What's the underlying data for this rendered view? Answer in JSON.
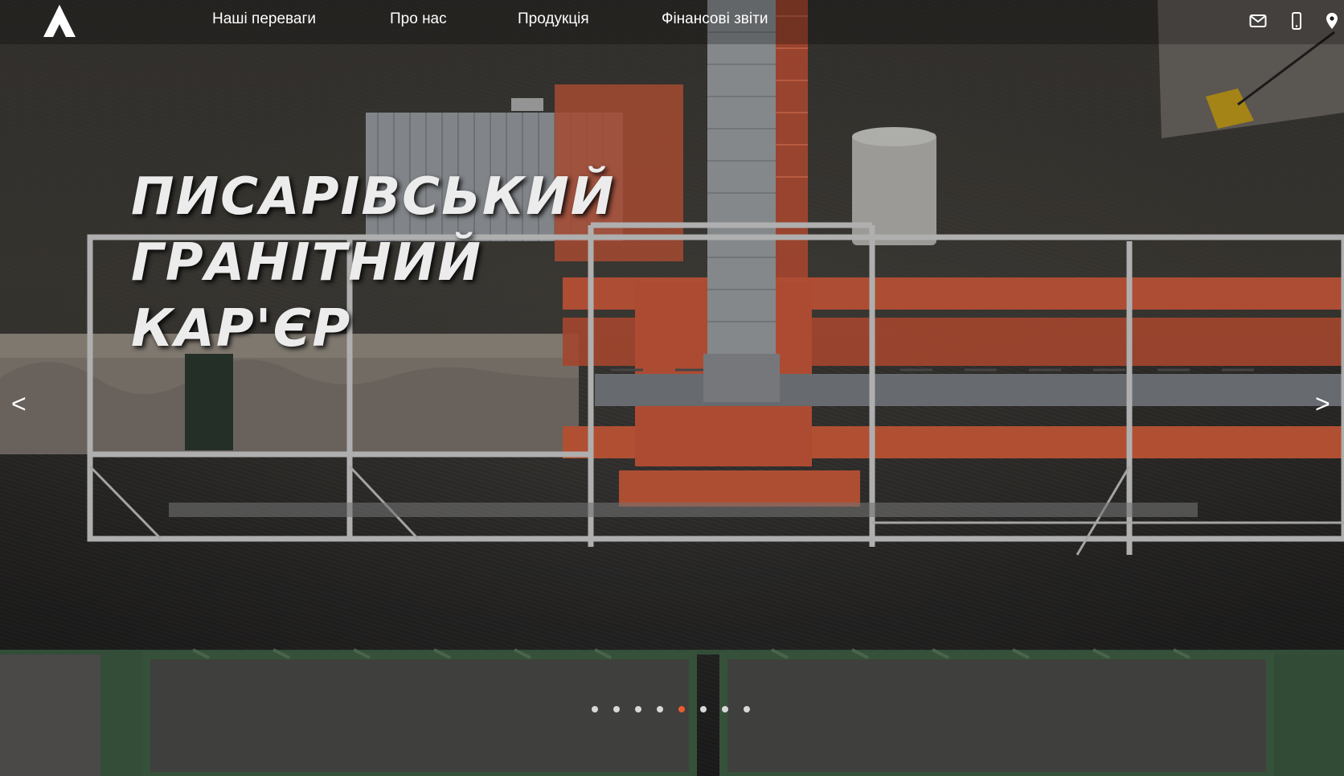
{
  "nav": {
    "logo_icon": "mountain-a-logo",
    "menu": [
      {
        "label": "Наші переваги"
      },
      {
        "label": "Про нас"
      },
      {
        "label": "Продукція"
      },
      {
        "label": "Фінансові звіти"
      }
    ],
    "icons": [
      "envelope-icon",
      "mobile-phone-icon",
      "map-pin-icon"
    ]
  },
  "hero": {
    "title_lines": [
      "ПИСАРІВСЬКИЙ",
      "ГРАНІТНИЙ",
      "КАР'ЄР"
    ],
    "prev_label": "<",
    "next_label": ">"
  },
  "slider": {
    "total_slides": 8,
    "active_slide": 5
  },
  "colors": {
    "accent": "#e85d32",
    "structure_orange": "#d9583a",
    "dot": "#d8d8d8",
    "text": "#ffffff"
  }
}
